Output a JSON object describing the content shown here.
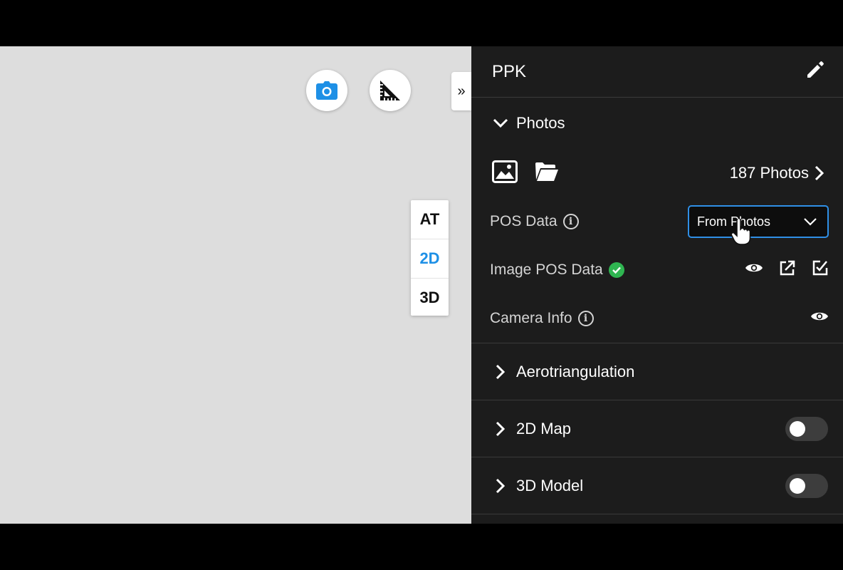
{
  "canvas": {
    "camera_icon": "camera-icon",
    "ruler_icon": "ruler-triangle-icon",
    "expand_label": "»",
    "view_modes": [
      {
        "label": "AT",
        "active": false
      },
      {
        "label": "2D",
        "active": true
      },
      {
        "label": "3D",
        "active": false
      }
    ]
  },
  "panel": {
    "title": "PPK",
    "edit_icon": "pencil-icon",
    "photos": {
      "label": "Photos",
      "count_label": "187 Photos",
      "pos_data_label": "POS Data",
      "pos_data_value": "From Photos",
      "image_pos_label": "Image POS Data",
      "camera_info_label": "Camera Info"
    },
    "sections": [
      {
        "label": "Aerotriangulation",
        "toggle": null
      },
      {
        "label": "2D Map",
        "toggle": false
      },
      {
        "label": "3D Model",
        "toggle": false
      }
    ]
  },
  "colors": {
    "accent": "#2f8fe6",
    "active_mode": "#1e90e6",
    "success": "#2fb551",
    "panel_bg": "#1c1c1c",
    "canvas_bg": "#dddddd"
  }
}
